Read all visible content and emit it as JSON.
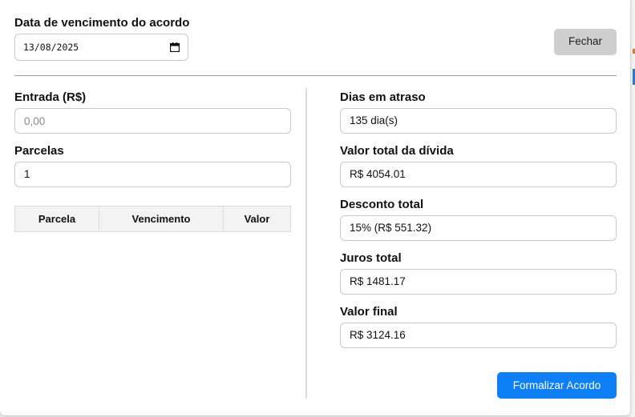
{
  "due_date": {
    "label": "Data de vencimento do acordo",
    "value": "13/08/2025"
  },
  "close_button": "Fechar",
  "entrada": {
    "label": "Entrada (R$)",
    "placeholder": "0,00",
    "value": ""
  },
  "parcelas": {
    "label": "Parcelas",
    "value": "1"
  },
  "installments_table": {
    "columns": [
      "Parcela",
      "Vencimento",
      "Valor"
    ],
    "rows": []
  },
  "summary": {
    "dias_atraso": {
      "label": "Dias em atraso",
      "value": "135 dia(s)"
    },
    "valor_total": {
      "label": "Valor total da dívida",
      "value": "R$ 4054.01"
    },
    "desconto_total": {
      "label": "Desconto total",
      "value": "15% (R$ 551.32)"
    },
    "juros_total": {
      "label": "Juros total",
      "value": "R$ 1481.17"
    },
    "valor_final": {
      "label": "Valor final",
      "value": "R$ 3124.16"
    }
  },
  "submit_button": "Formalizar Acordo",
  "colors": {
    "primary": "#0d7ff7",
    "secondary_button": "#cfcfcf"
  }
}
